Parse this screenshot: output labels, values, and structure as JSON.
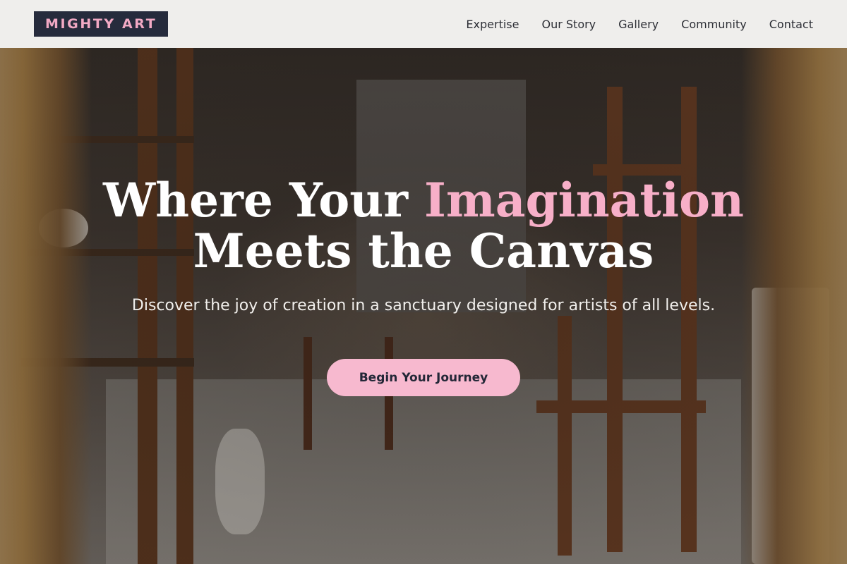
{
  "brand": {
    "logo_text": "MIGHTY ART"
  },
  "nav": {
    "items": [
      "Expertise",
      "Our Story",
      "Gallery",
      "Community",
      "Contact"
    ]
  },
  "hero": {
    "headline_part1": "Where Your ",
    "headline_accent": "Imagination",
    "headline_part2": "Meets the Canvas",
    "subtext": "Discover the joy of creation in a sanctuary designed for artists of all levels.",
    "cta_label": "Begin Your Journey",
    "background_image": "art-studio-photo"
  },
  "colors": {
    "header_bg": "#efeeec",
    "logo_bg": "#262b3c",
    "accent_pink": "#f7afc8",
    "cta_bg": "#f7b9cf",
    "nav_text": "#2d2f36"
  }
}
